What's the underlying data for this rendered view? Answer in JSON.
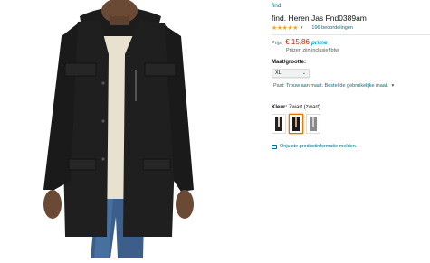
{
  "product": {
    "brand": "find.",
    "title": "find. Heren Jas Fnd0389am",
    "rating_stars": "★★★★★",
    "rating_value": 4.5,
    "reviews": "196 beoordelingen"
  },
  "price": {
    "label": "Prijs:",
    "value": "€ 15,86",
    "prime": "prime",
    "tax_note": "Prijzen zijn inclusief btw."
  },
  "size": {
    "label": "Maat/grootte:",
    "selected": "XL"
  },
  "fit": {
    "label": "Past:",
    "link": "Trouw aan maat. Bestel de gebruikelijke maat."
  },
  "color": {
    "label": "Kleur:",
    "value": "Zwart (zwart)",
    "swatches": [
      {
        "name": "black",
        "coat": "#222222",
        "inner": "#d8d0c0"
      },
      {
        "name": "black-selected",
        "coat": "#1a1a1a",
        "inner": "#c9a27a"
      },
      {
        "name": "grey",
        "coat": "#8a8a8a",
        "inner": "#cfcfcf"
      }
    ]
  },
  "report": {
    "text": "Onjuiste productinformatie melden."
  },
  "colors": {
    "link": "#007185",
    "price": "#b12704",
    "prime": "#00a8e1",
    "star": "#ffa41c",
    "selected": "#e77600"
  }
}
